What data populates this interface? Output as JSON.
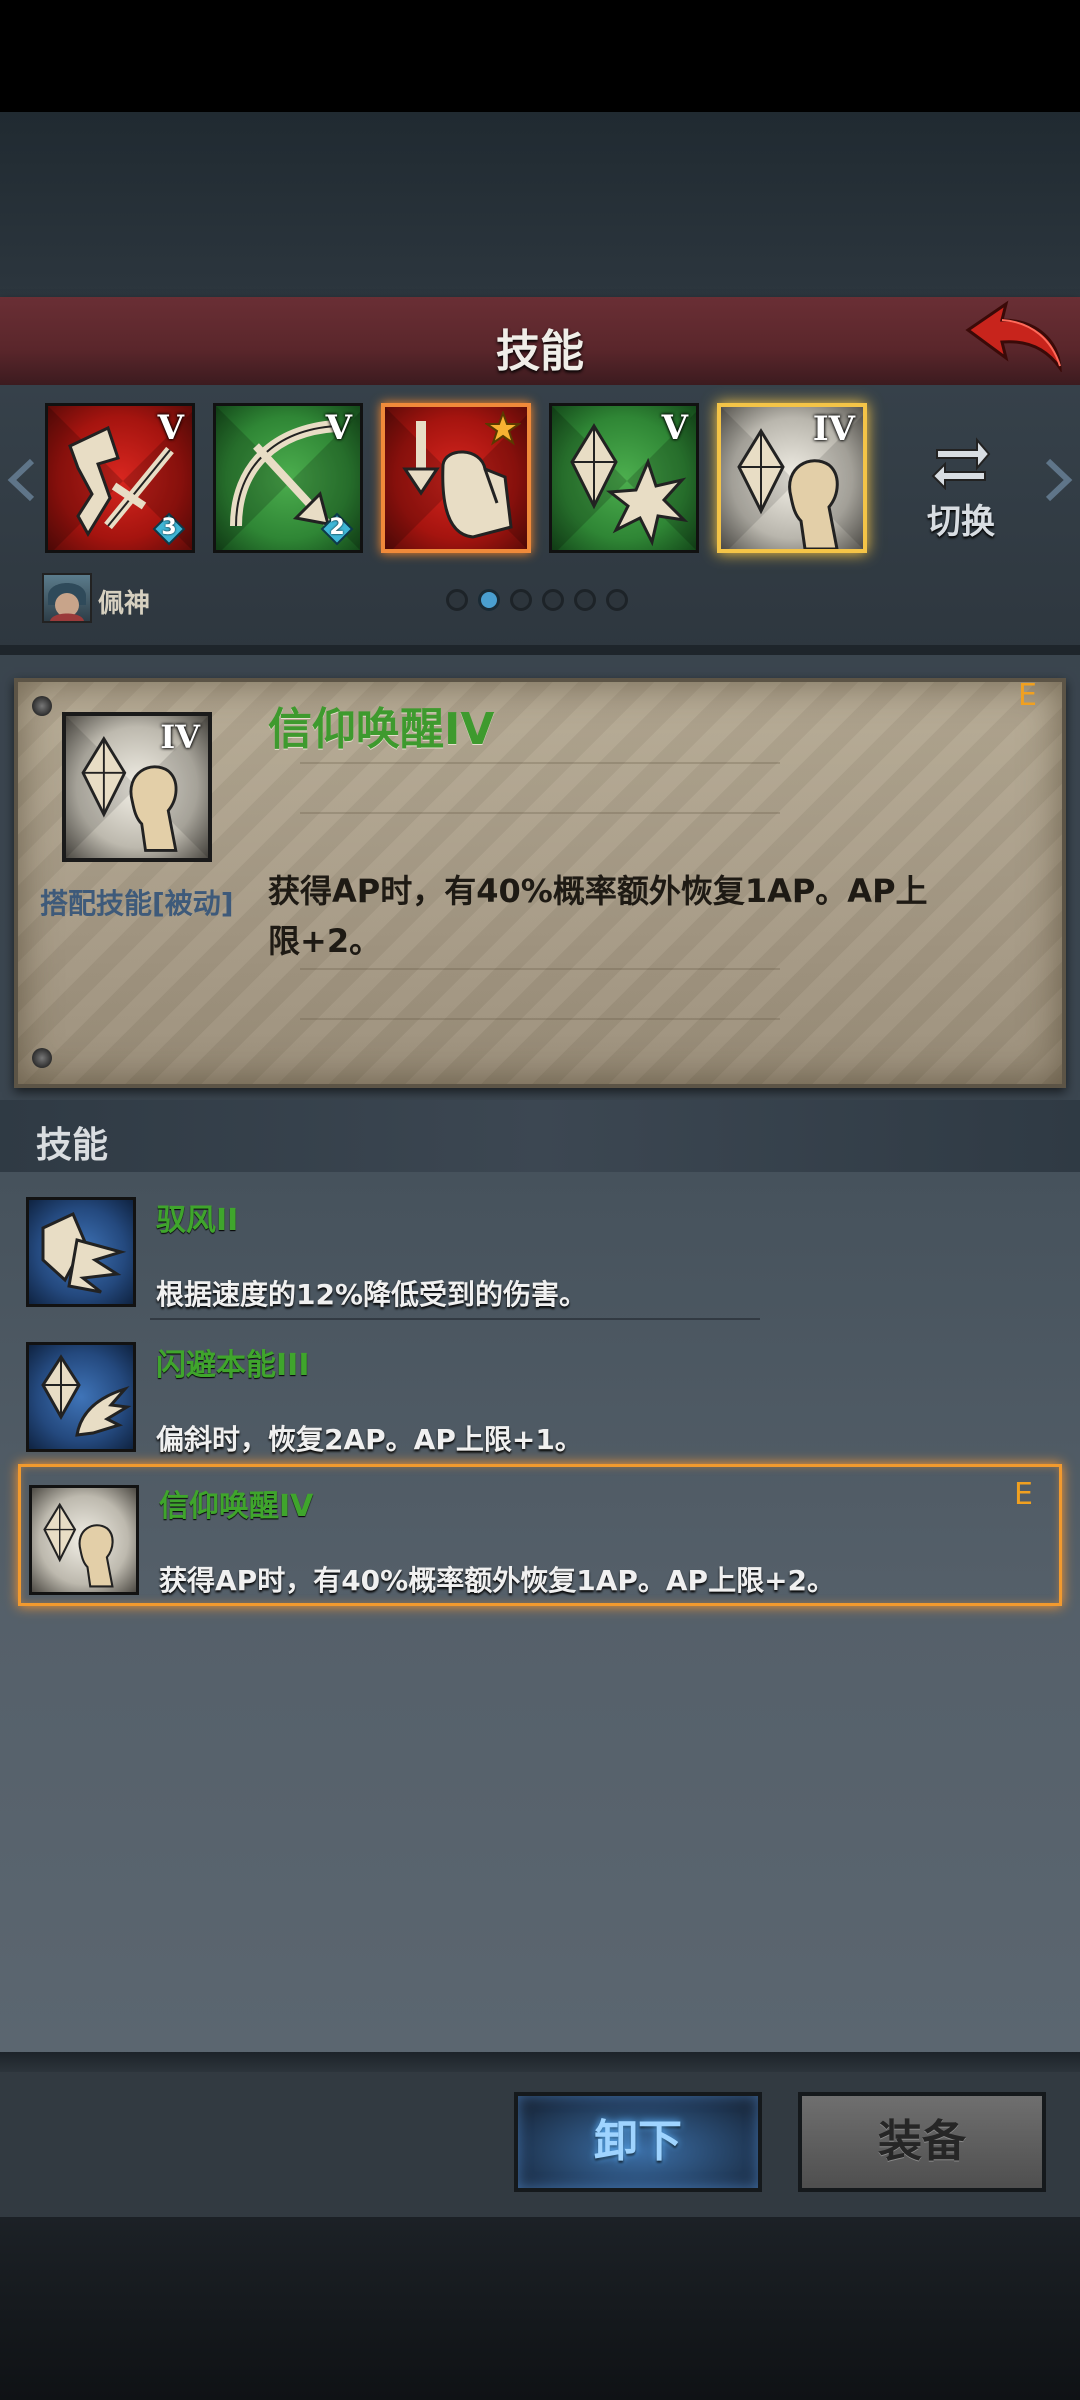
{
  "header": {
    "title": "技能"
  },
  "skill_slots": [
    {
      "level": "V",
      "color": "red",
      "badge": "3"
    },
    {
      "level": "V",
      "color": "green",
      "badge": "2"
    },
    {
      "level": "",
      "color": "red",
      "badge": "",
      "star": true
    },
    {
      "level": "V",
      "color": "green",
      "badge": ""
    },
    {
      "level": "IV",
      "color": "pale",
      "badge": ""
    }
  ],
  "switch_label": "切换",
  "character": {
    "name": "佩神"
  },
  "pager": {
    "count": 6,
    "active": 1
  },
  "detail": {
    "level": "IV",
    "type_tag": "搭配技能[被动]",
    "title": "信仰唤醒IV",
    "grade": "E",
    "description": "获得AP时，有40%概率额外恢复1AP。AP上限+2。"
  },
  "section_title": "技能",
  "skill_list": [
    {
      "name": "驭风II",
      "desc": "根据速度的12%降低受到的伤害。",
      "icon": "shield-wind-icon",
      "color": "blue",
      "grade": ""
    },
    {
      "name": "闪避本能III",
      "desc": "偏斜时，恢复2AP。AP上限+1。",
      "icon": "crystal-wing-icon",
      "color": "blue",
      "grade": ""
    },
    {
      "name": "信仰唤醒IV",
      "desc": "获得AP时，有40%概率额外恢复1AP。AP上限+2。",
      "icon": "crystal-hand-icon",
      "color": "pale",
      "grade": "E"
    }
  ],
  "buttons": {
    "unload": "卸下",
    "equip": "装备"
  }
}
